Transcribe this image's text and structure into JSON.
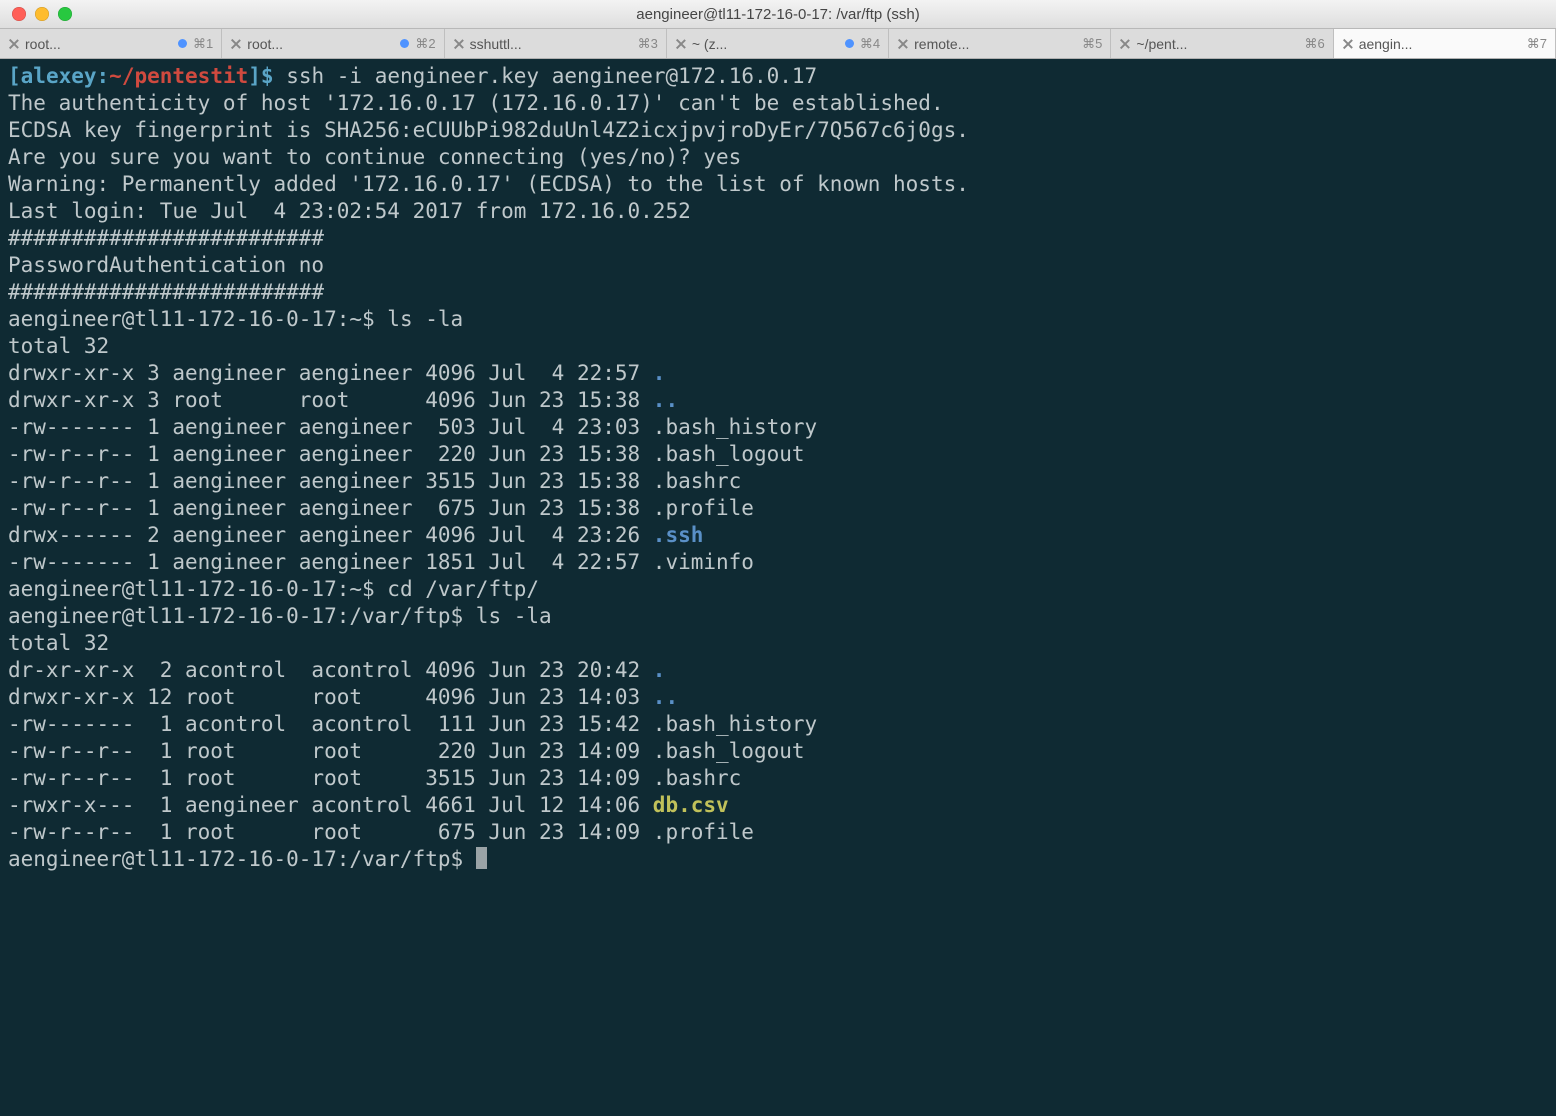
{
  "window": {
    "title": "aengineer@tl11-172-16-0-17: /var/ftp (ssh)"
  },
  "tabs": [
    {
      "label": "root...",
      "dot": true,
      "shortcut": "⌘1"
    },
    {
      "label": "root...",
      "dot": true,
      "shortcut": "⌘2"
    },
    {
      "label": "sshuttl...",
      "dot": false,
      "shortcut": "⌘3"
    },
    {
      "label": "~ (z...",
      "dot": true,
      "shortcut": "⌘4"
    },
    {
      "label": "remote...",
      "dot": false,
      "shortcut": "⌘5"
    },
    {
      "label": "~/pent...",
      "dot": false,
      "shortcut": "⌘6"
    },
    {
      "label": "aengin...",
      "dot": false,
      "shortcut": "⌘7",
      "active": true
    }
  ],
  "prompt": {
    "open": "[",
    "user": "alexey",
    "sep": ":",
    "path": "~/pentestit",
    "close": "]$ ",
    "cmd": "ssh -i aengineer.key aengineer@172.16.0.17"
  },
  "ssh": {
    "line1": "The authenticity of host '172.16.0.17 (172.16.0.17)' can't be established.",
    "line2": "ECDSA key fingerprint is SHA256:eCUUbPi982duUnl4Z2icxjpvjroDyEr/7Q567c6j0gs.",
    "line3": "Are you sure you want to continue connecting (yes/no)? yes",
    "line4": "Warning: Permanently added '172.16.0.17' (ECDSA) to the list of known hosts.",
    "line5": "Last login: Tue Jul  4 23:02:54 2017 from 172.16.0.252",
    "hashes": "#########################",
    "authno": "PasswordAuthentication no"
  },
  "rprompt": {
    "home": "aengineer@tl11-172-16-0-17:~$ ",
    "ftp": "aengineer@tl11-172-16-0-17:/var/ftp$ "
  },
  "cmd1": "ls -la",
  "cmd2": "cd /var/ftp/",
  "cmd3": "ls -la",
  "ls1": {
    "total": "total 32",
    "rows": [
      {
        "pre": "drwxr-xr-x 3 aengineer aengineer 4096 Jul  4 22:57 ",
        "name": ".",
        "cls": "blue bold"
      },
      {
        "pre": "drwxr-xr-x 3 root      root      4096 Jun 23 15:38 ",
        "name": "..",
        "cls": "blue bold"
      },
      {
        "pre": "-rw------- 1 aengineer aengineer  503 Jul  4 23:03 ",
        "name": ".bash_history",
        "cls": ""
      },
      {
        "pre": "-rw-r--r-- 1 aengineer aengineer  220 Jun 23 15:38 ",
        "name": ".bash_logout",
        "cls": ""
      },
      {
        "pre": "-rw-r--r-- 1 aengineer aengineer 3515 Jun 23 15:38 ",
        "name": ".bashrc",
        "cls": ""
      },
      {
        "pre": "-rw-r--r-- 1 aengineer aengineer  675 Jun 23 15:38 ",
        "name": ".profile",
        "cls": ""
      },
      {
        "pre": "drwx------ 2 aengineer aengineer 4096 Jul  4 23:26 ",
        "name": ".ssh",
        "cls": "blue bold"
      },
      {
        "pre": "-rw------- 1 aengineer aengineer 1851 Jul  4 22:57 ",
        "name": ".viminfo",
        "cls": ""
      }
    ]
  },
  "ls2": {
    "total": "total 32",
    "rows": [
      {
        "pre": "dr-xr-xr-x  2 acontrol  acontrol 4096 Jun 23 20:42 ",
        "name": ".",
        "cls": "blue bold"
      },
      {
        "pre": "drwxr-xr-x 12 root      root     4096 Jun 23 14:03 ",
        "name": "..",
        "cls": "blue bold"
      },
      {
        "pre": "-rw-------  1 acontrol  acontrol  111 Jun 23 15:42 ",
        "name": ".bash_history",
        "cls": ""
      },
      {
        "pre": "-rw-r--r--  1 root      root      220 Jun 23 14:09 ",
        "name": ".bash_logout",
        "cls": ""
      },
      {
        "pre": "-rw-r--r--  1 root      root     3515 Jun 23 14:09 ",
        "name": ".bashrc",
        "cls": ""
      },
      {
        "pre": "-rwxr-x---  1 aengineer acontrol 4661 Jul 12 14:06 ",
        "name": "db.csv",
        "cls": "yellow bold"
      },
      {
        "pre": "-rw-r--r--  1 root      root      675 Jun 23 14:09 ",
        "name": ".profile",
        "cls": ""
      }
    ]
  }
}
